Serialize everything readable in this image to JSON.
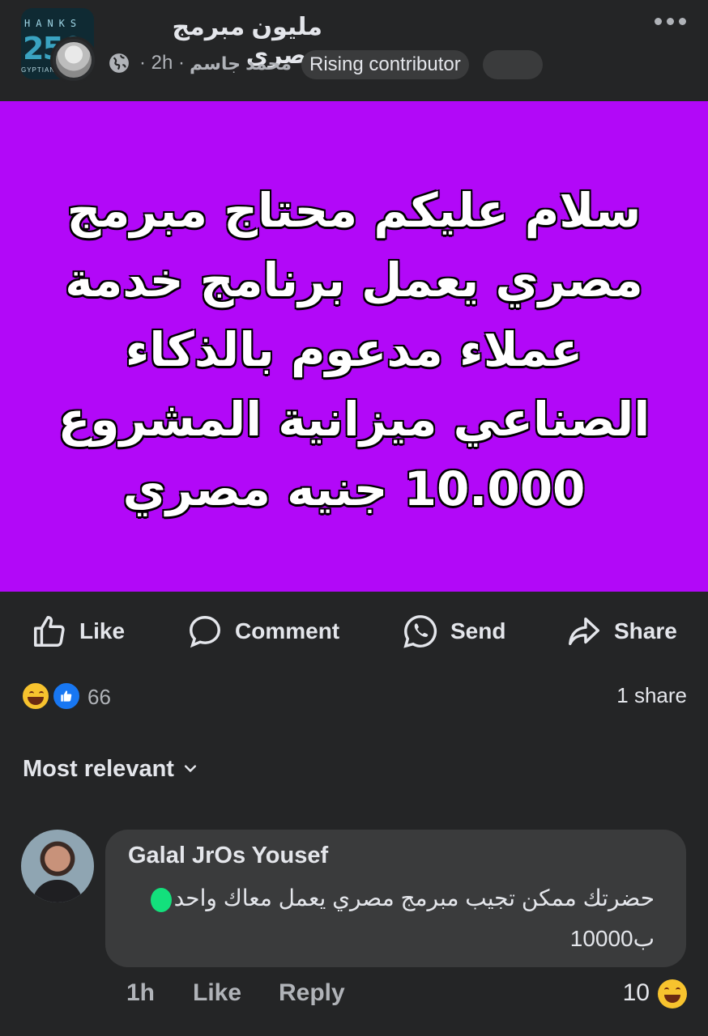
{
  "post": {
    "group_avatar_text_top": "HANKS",
    "group_avatar_text_num": "250",
    "group_avatar_text_bottom": "GYPTIAN",
    "group_name": "مليون مبرمج مصري",
    "author": "محمد جاسم",
    "time": "· 2h ·",
    "badge": "Rising contributor",
    "image_text": "سلام عليكم محتاج مبرمج مصري يعمل برنامج خدمة عملاء مدعوم بالذكاء الصناعي ميزانية المشروع 10.000 جنيه مصري",
    "image_bg_color": "#b208f8"
  },
  "actions": {
    "like": "Like",
    "comment": "Comment",
    "send": "Send",
    "share": "Share"
  },
  "stats": {
    "reactions_count": "66",
    "shares": "1 share"
  },
  "sort": {
    "label": "Most relevant"
  },
  "comment": {
    "name": "Galal JrOs Yousef",
    "text": "حضرتك ممكن تجيب مبرمج مصري يعمل معاك واحد ب10000",
    "time": "1h",
    "like": "Like",
    "reply": "Reply",
    "reactions_count": "10"
  },
  "colors": {
    "background": "#242526",
    "bubble": "#3a3b3c",
    "accent_like": "#1877f2"
  }
}
